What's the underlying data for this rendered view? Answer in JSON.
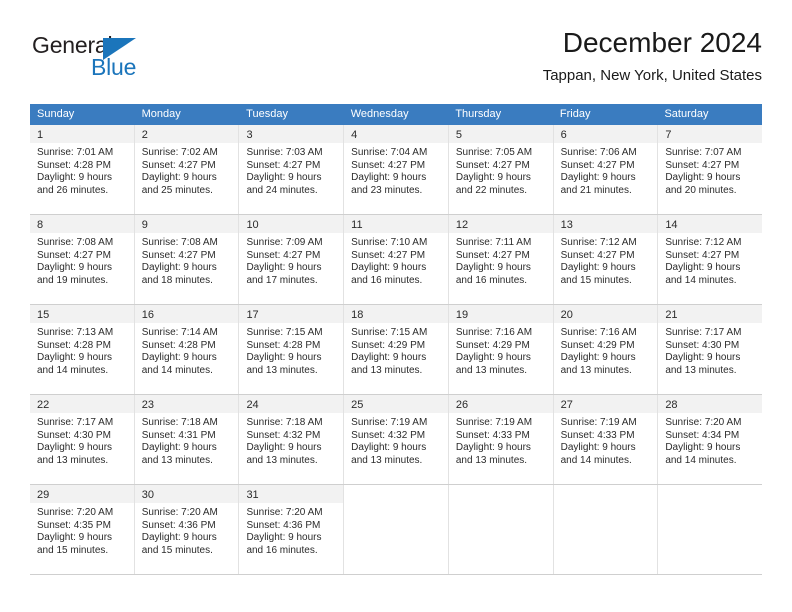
{
  "logo": {
    "word_top": "General",
    "word_bottom": "Blue",
    "triangle_color": "#1b75bb",
    "text_color": "#231f20"
  },
  "header": {
    "title": "December 2024",
    "subtitle": "Tappan, New York, United States"
  },
  "theme": {
    "header_blue": "#3a7cc0",
    "daynum_band": "#f2f2f2",
    "grid_line": "#cfcfcf"
  },
  "weekdays": [
    "Sunday",
    "Monday",
    "Tuesday",
    "Wednesday",
    "Thursday",
    "Friday",
    "Saturday"
  ],
  "weeks": [
    [
      {
        "day": "1",
        "sunrise": "Sunrise: 7:01 AM",
        "sunset": "Sunset: 4:28 PM",
        "daylight_1": "Daylight: 9 hours",
        "daylight_2": "and 26 minutes."
      },
      {
        "day": "2",
        "sunrise": "Sunrise: 7:02 AM",
        "sunset": "Sunset: 4:27 PM",
        "daylight_1": "Daylight: 9 hours",
        "daylight_2": "and 25 minutes."
      },
      {
        "day": "3",
        "sunrise": "Sunrise: 7:03 AM",
        "sunset": "Sunset: 4:27 PM",
        "daylight_1": "Daylight: 9 hours",
        "daylight_2": "and 24 minutes."
      },
      {
        "day": "4",
        "sunrise": "Sunrise: 7:04 AM",
        "sunset": "Sunset: 4:27 PM",
        "daylight_1": "Daylight: 9 hours",
        "daylight_2": "and 23 minutes."
      },
      {
        "day": "5",
        "sunrise": "Sunrise: 7:05 AM",
        "sunset": "Sunset: 4:27 PM",
        "daylight_1": "Daylight: 9 hours",
        "daylight_2": "and 22 minutes."
      },
      {
        "day": "6",
        "sunrise": "Sunrise: 7:06 AM",
        "sunset": "Sunset: 4:27 PM",
        "daylight_1": "Daylight: 9 hours",
        "daylight_2": "and 21 minutes."
      },
      {
        "day": "7",
        "sunrise": "Sunrise: 7:07 AM",
        "sunset": "Sunset: 4:27 PM",
        "daylight_1": "Daylight: 9 hours",
        "daylight_2": "and 20 minutes."
      }
    ],
    [
      {
        "day": "8",
        "sunrise": "Sunrise: 7:08 AM",
        "sunset": "Sunset: 4:27 PM",
        "daylight_1": "Daylight: 9 hours",
        "daylight_2": "and 19 minutes."
      },
      {
        "day": "9",
        "sunrise": "Sunrise: 7:08 AM",
        "sunset": "Sunset: 4:27 PM",
        "daylight_1": "Daylight: 9 hours",
        "daylight_2": "and 18 minutes."
      },
      {
        "day": "10",
        "sunrise": "Sunrise: 7:09 AM",
        "sunset": "Sunset: 4:27 PM",
        "daylight_1": "Daylight: 9 hours",
        "daylight_2": "and 17 minutes."
      },
      {
        "day": "11",
        "sunrise": "Sunrise: 7:10 AM",
        "sunset": "Sunset: 4:27 PM",
        "daylight_1": "Daylight: 9 hours",
        "daylight_2": "and 16 minutes."
      },
      {
        "day": "12",
        "sunrise": "Sunrise: 7:11 AM",
        "sunset": "Sunset: 4:27 PM",
        "daylight_1": "Daylight: 9 hours",
        "daylight_2": "and 16 minutes."
      },
      {
        "day": "13",
        "sunrise": "Sunrise: 7:12 AM",
        "sunset": "Sunset: 4:27 PM",
        "daylight_1": "Daylight: 9 hours",
        "daylight_2": "and 15 minutes."
      },
      {
        "day": "14",
        "sunrise": "Sunrise: 7:12 AM",
        "sunset": "Sunset: 4:27 PM",
        "daylight_1": "Daylight: 9 hours",
        "daylight_2": "and 14 minutes."
      }
    ],
    [
      {
        "day": "15",
        "sunrise": "Sunrise: 7:13 AM",
        "sunset": "Sunset: 4:28 PM",
        "daylight_1": "Daylight: 9 hours",
        "daylight_2": "and 14 minutes."
      },
      {
        "day": "16",
        "sunrise": "Sunrise: 7:14 AM",
        "sunset": "Sunset: 4:28 PM",
        "daylight_1": "Daylight: 9 hours",
        "daylight_2": "and 14 minutes."
      },
      {
        "day": "17",
        "sunrise": "Sunrise: 7:15 AM",
        "sunset": "Sunset: 4:28 PM",
        "daylight_1": "Daylight: 9 hours",
        "daylight_2": "and 13 minutes."
      },
      {
        "day": "18",
        "sunrise": "Sunrise: 7:15 AM",
        "sunset": "Sunset: 4:29 PM",
        "daylight_1": "Daylight: 9 hours",
        "daylight_2": "and 13 minutes."
      },
      {
        "day": "19",
        "sunrise": "Sunrise: 7:16 AM",
        "sunset": "Sunset: 4:29 PM",
        "daylight_1": "Daylight: 9 hours",
        "daylight_2": "and 13 minutes."
      },
      {
        "day": "20",
        "sunrise": "Sunrise: 7:16 AM",
        "sunset": "Sunset: 4:29 PM",
        "daylight_1": "Daylight: 9 hours",
        "daylight_2": "and 13 minutes."
      },
      {
        "day": "21",
        "sunrise": "Sunrise: 7:17 AM",
        "sunset": "Sunset: 4:30 PM",
        "daylight_1": "Daylight: 9 hours",
        "daylight_2": "and 13 minutes."
      }
    ],
    [
      {
        "day": "22",
        "sunrise": "Sunrise: 7:17 AM",
        "sunset": "Sunset: 4:30 PM",
        "daylight_1": "Daylight: 9 hours",
        "daylight_2": "and 13 minutes."
      },
      {
        "day": "23",
        "sunrise": "Sunrise: 7:18 AM",
        "sunset": "Sunset: 4:31 PM",
        "daylight_1": "Daylight: 9 hours",
        "daylight_2": "and 13 minutes."
      },
      {
        "day": "24",
        "sunrise": "Sunrise: 7:18 AM",
        "sunset": "Sunset: 4:32 PM",
        "daylight_1": "Daylight: 9 hours",
        "daylight_2": "and 13 minutes."
      },
      {
        "day": "25",
        "sunrise": "Sunrise: 7:19 AM",
        "sunset": "Sunset: 4:32 PM",
        "daylight_1": "Daylight: 9 hours",
        "daylight_2": "and 13 minutes."
      },
      {
        "day": "26",
        "sunrise": "Sunrise: 7:19 AM",
        "sunset": "Sunset: 4:33 PM",
        "daylight_1": "Daylight: 9 hours",
        "daylight_2": "and 13 minutes."
      },
      {
        "day": "27",
        "sunrise": "Sunrise: 7:19 AM",
        "sunset": "Sunset: 4:33 PM",
        "daylight_1": "Daylight: 9 hours",
        "daylight_2": "and 14 minutes."
      },
      {
        "day": "28",
        "sunrise": "Sunrise: 7:20 AM",
        "sunset": "Sunset: 4:34 PM",
        "daylight_1": "Daylight: 9 hours",
        "daylight_2": "and 14 minutes."
      }
    ],
    [
      {
        "day": "29",
        "sunrise": "Sunrise: 7:20 AM",
        "sunset": "Sunset: 4:35 PM",
        "daylight_1": "Daylight: 9 hours",
        "daylight_2": "and 15 minutes."
      },
      {
        "day": "30",
        "sunrise": "Sunrise: 7:20 AM",
        "sunset": "Sunset: 4:36 PM",
        "daylight_1": "Daylight: 9 hours",
        "daylight_2": "and 15 minutes."
      },
      {
        "day": "31",
        "sunrise": "Sunrise: 7:20 AM",
        "sunset": "Sunset: 4:36 PM",
        "daylight_1": "Daylight: 9 hours",
        "daylight_2": "and 16 minutes."
      },
      {
        "day": "",
        "sunrise": "",
        "sunset": "",
        "daylight_1": "",
        "daylight_2": ""
      },
      {
        "day": "",
        "sunrise": "",
        "sunset": "",
        "daylight_1": "",
        "daylight_2": ""
      },
      {
        "day": "",
        "sunrise": "",
        "sunset": "",
        "daylight_1": "",
        "daylight_2": ""
      },
      {
        "day": "",
        "sunrise": "",
        "sunset": "",
        "daylight_1": "",
        "daylight_2": ""
      }
    ]
  ]
}
